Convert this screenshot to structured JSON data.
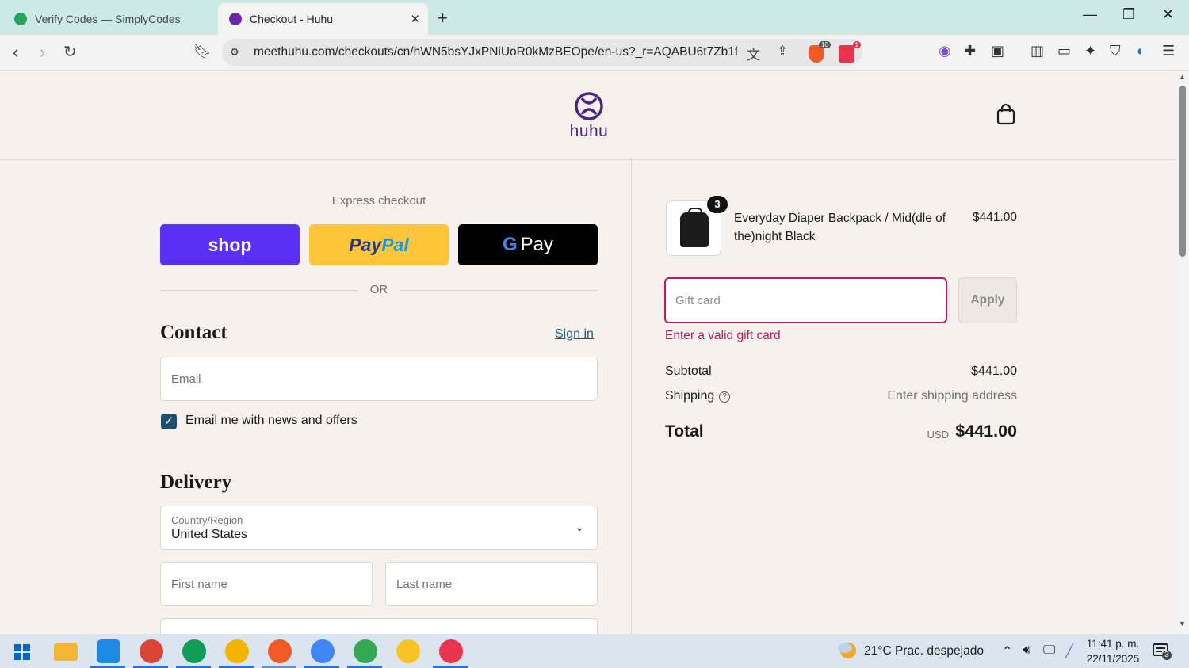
{
  "browser": {
    "tabs": [
      {
        "title": "Verify Codes — SimplyCodes",
        "active": false
      },
      {
        "title": "Checkout - Huhu",
        "active": true
      }
    ],
    "url": "meethuhu.com/checkouts/cn/hWN5bsYJxPNiUoR0kMzBEOpe/en-us?_r=AQABU6t7Zb1f...",
    "brave_shield_count": "10",
    "rewards_badge": "1"
  },
  "store": {
    "logo_text": "huhu",
    "brand_color": "#4a2483"
  },
  "checkout": {
    "express_label": "Express checkout",
    "shop_label": "shop",
    "paypal_label_1": "Pay",
    "paypal_label_2": "Pal",
    "gpay_label_g": "G",
    "gpay_label": "Pay",
    "or_label": "OR",
    "contact_heading": "Contact",
    "sign_in": "Sign in",
    "email_placeholder": "Email",
    "news_checkbox_label": "Email me with news and offers",
    "news_checked": true,
    "delivery_heading": "Delivery",
    "country_label": "Country/Region",
    "country_value": "United States",
    "first_name_placeholder": "First name",
    "last_name_placeholder": "Last name"
  },
  "summary": {
    "item": {
      "name": "Everyday Diaper Backpack / Mid(dle of the)night Black",
      "quantity": "3",
      "price": "$441.00"
    },
    "gift_card_placeholder": "Gift card",
    "apply_label": "Apply",
    "gift_card_error": "Enter a valid gift card",
    "subtotal_label": "Subtotal",
    "subtotal_value": "$441.00",
    "shipping_label": "Shipping",
    "shipping_value": "Enter shipping address",
    "total_label": "Total",
    "total_currency": "USD",
    "total_value": "$441.00",
    "error_color": "#c2185b"
  },
  "taskbar": {
    "weather": "21°C  Prac. despejado",
    "time": "11:41 p. m.",
    "date": "22/11/2025",
    "notifications": "3"
  }
}
